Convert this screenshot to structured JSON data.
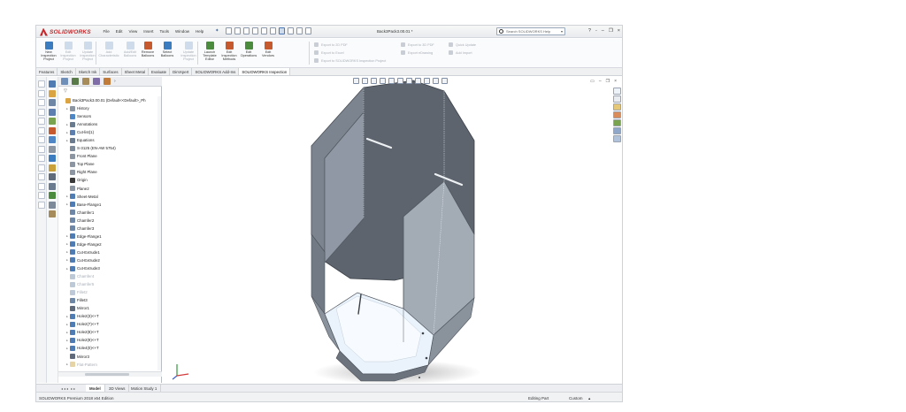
{
  "app": {
    "logo": "SOLIDWORKS",
    "document_title": "Back3Pack3.00.01 *",
    "menu": [
      "File",
      "Edit",
      "View",
      "Insert",
      "Tools",
      "Window",
      "Help"
    ],
    "search_placeholder": "Search SOLIDWORKS Help",
    "window_controls": [
      "?",
      "-",
      "–",
      "❐",
      "×"
    ]
  },
  "ribbon": {
    "buttons": [
      {
        "label": "New\nInspection\nProject",
        "enabled": true,
        "color": "#3b7bbf"
      },
      {
        "label": "Edit\nInspection\nProject",
        "enabled": false,
        "color": "#7aa0c8"
      },
      {
        "label": "Update\nInspection\nProject",
        "enabled": false,
        "color": "#7aa0c8"
      },
      {
        "label": "Add\nCharacteristic",
        "enabled": false,
        "color": "#7aa0c8"
      },
      {
        "label": "Add/Edit\nBalloons",
        "enabled": false,
        "color": "#7aa0c8"
      },
      {
        "label": "Remove\nBalloons",
        "enabled": true,
        "color": "#c65a2e"
      },
      {
        "label": "Select\nBalloons",
        "enabled": true,
        "color": "#3b7bbf"
      },
      {
        "label": "Update\nInspection\nProject",
        "enabled": false,
        "color": "#7aa0c8"
      },
      {
        "label": "Launch\nTemplate\nEditor",
        "enabled": true,
        "color": "#4a8b3e"
      },
      {
        "label": "Edit\nInspection\nMethods",
        "enabled": true,
        "color": "#c65a2e"
      },
      {
        "label": "Edit\nOperations",
        "enabled": true,
        "color": "#4a8b3e"
      },
      {
        "label": "Edit\nVendors",
        "enabled": true,
        "color": "#c65a2e"
      }
    ],
    "small_items": [
      "Export to 2D PDF",
      "Export to Excel",
      "Export to SOLIDWORKS Inspection Project",
      "Export to 3D PDF",
      "Export eDrawing",
      "Quick Update",
      "Add Import"
    ]
  },
  "command_tabs": [
    {
      "label": "Features",
      "active": false
    },
    {
      "label": "Sketch",
      "active": false
    },
    {
      "label": "Sketch Ink",
      "active": false
    },
    {
      "label": "Surfaces",
      "active": false
    },
    {
      "label": "Sheet Metal",
      "active": false
    },
    {
      "label": "Evaluate",
      "active": false
    },
    {
      "label": "DimXpert",
      "active": false
    },
    {
      "label": "SOLIDWORKS Add-Ins",
      "active": false
    },
    {
      "label": "SOLIDWORKS Inspection",
      "active": true
    }
  ],
  "feature_tree": [
    {
      "label": "Back3Pack3.00.01 (Default<<Default>_Ph",
      "icon": "#d9a441",
      "tw": "",
      "level": 0,
      "sup": false
    },
    {
      "label": "History",
      "icon": "#8c96a3",
      "tw": "▸",
      "level": 1,
      "sup": false
    },
    {
      "label": "Sensors",
      "icon": "#4f86c6",
      "tw": "",
      "level": 1,
      "sup": false
    },
    {
      "label": "Annotations",
      "icon": "#6b7b8f",
      "tw": "▸",
      "level": 1,
      "sup": false
    },
    {
      "label": "Cut-list(1)",
      "icon": "#5d7fb0",
      "tw": "▸",
      "level": 1,
      "sup": false
    },
    {
      "label": "Equations",
      "icon": "#6b7b8f",
      "tw": "▸",
      "level": 1,
      "sup": false
    },
    {
      "label": "S-3125 (EN-AW 5754)",
      "icon": "#7d8a99",
      "tw": "",
      "level": 1,
      "sup": false
    },
    {
      "label": "Front Plane",
      "icon": "#8c96a3",
      "tw": "",
      "level": 1,
      "sup": false
    },
    {
      "label": "Top Plane",
      "icon": "#8c96a3",
      "tw": "",
      "level": 1,
      "sup": false
    },
    {
      "label": "Right Plane",
      "icon": "#8c96a3",
      "tw": "",
      "level": 1,
      "sup": false
    },
    {
      "label": "Origin",
      "icon": "#3a3a3a",
      "tw": "",
      "level": 1,
      "sup": false
    },
    {
      "label": "Plane2",
      "icon": "#8c96a3",
      "tw": "",
      "level": 1,
      "sup": false
    },
    {
      "label": "Sheet-Metal",
      "icon": "#4f7db3",
      "tw": "▸",
      "level": 1,
      "sup": false
    },
    {
      "label": "Base-Flange1",
      "icon": "#4f7db3",
      "tw": "▸",
      "level": 1,
      "sup": false
    },
    {
      "label": "Chamfer1",
      "icon": "#6f87a6",
      "tw": "",
      "level": 1,
      "sup": false
    },
    {
      "label": "Chamfer2",
      "icon": "#6f87a6",
      "tw": "",
      "level": 1,
      "sup": false
    },
    {
      "label": "Chamfer3",
      "icon": "#6f87a6",
      "tw": "",
      "level": 1,
      "sup": false
    },
    {
      "label": "Edge-Flange1",
      "icon": "#4f7db3",
      "tw": "▸",
      "level": 1,
      "sup": false
    },
    {
      "label": "Edge-Flange2",
      "icon": "#4f7db3",
      "tw": "▸",
      "level": 1,
      "sup": false
    },
    {
      "label": "Cut-Extrude1",
      "icon": "#4f7db3",
      "tw": "▸",
      "level": 1,
      "sup": false
    },
    {
      "label": "Cut-Extrude2",
      "icon": "#4f7db3",
      "tw": "▸",
      "level": 1,
      "sup": false
    },
    {
      "label": "Cut-Extrude3",
      "icon": "#4f7db3",
      "tw": "▸",
      "level": 1,
      "sup": false
    },
    {
      "label": "Chamfer4",
      "icon": "#6f87a6",
      "tw": "",
      "level": 1,
      "sup": true
    },
    {
      "label": "Chamfer5",
      "icon": "#6f87a6",
      "tw": "",
      "level": 1,
      "sup": true
    },
    {
      "label": "Fillet2",
      "icon": "#6f87a6",
      "tw": "",
      "level": 1,
      "sup": true
    },
    {
      "label": "Fillet3",
      "icon": "#6f87a6",
      "tw": "",
      "level": 1,
      "sup": false
    },
    {
      "label": "Mirror1",
      "icon": "#5f6b7a",
      "tw": "",
      "level": 1,
      "sup": false
    },
    {
      "label": "Hole2(3)<+T",
      "icon": "#4f7db3",
      "tw": "▸",
      "level": 1,
      "sup": false
    },
    {
      "label": "Hole2(7)<+T",
      "icon": "#4f7db3",
      "tw": "▸",
      "level": 1,
      "sup": false
    },
    {
      "label": "Hole2(8)<+T",
      "icon": "#4f7db3",
      "tw": "▸",
      "level": 1,
      "sup": false
    },
    {
      "label": "Hole2(9)<+T",
      "icon": "#4f7db3",
      "tw": "▸",
      "level": 1,
      "sup": false
    },
    {
      "label": "Hole4(0)<+T",
      "icon": "#4f7db3",
      "tw": "▸",
      "level": 1,
      "sup": false
    },
    {
      "label": "Mirror3",
      "icon": "#5f6b7a",
      "tw": "",
      "level": 1,
      "sup": false
    },
    {
      "label": "Flat-Pattern",
      "icon": "#c9a03a",
      "tw": "▸",
      "level": 1,
      "sup": true
    }
  ],
  "bottom_tabs": [
    {
      "label": "Model",
      "active": true
    },
    {
      "label": "3D Views",
      "active": false
    },
    {
      "label": "Motion Study 1",
      "active": false
    }
  ],
  "status": {
    "left": "SOLIDWORKS Premium 2018 x64 Edition",
    "mode": "Editing Part",
    "units": "Custom"
  },
  "triad": {
    "x": "X",
    "y": "Y",
    "z": "Z"
  },
  "colors": {
    "accent": "#3b7bbf",
    "brand": "#c3272b",
    "part_face_dark": "#5a616c",
    "part_face_light": "#e9f1fa"
  }
}
